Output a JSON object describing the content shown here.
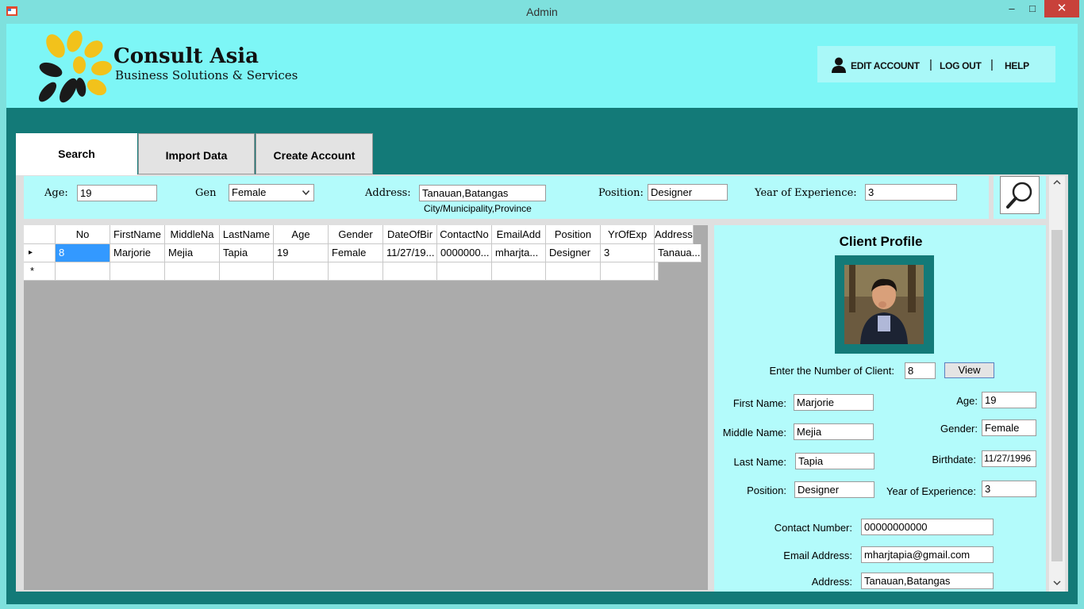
{
  "window": {
    "title": "Admin",
    "minimize": "–",
    "maximize": "□",
    "close": "✕"
  },
  "brand": {
    "name": "Consult Asia",
    "tagline": "Business Solutions & Services"
  },
  "header": {
    "edit_account": "EDIT ACCOUNT",
    "log_out": "LOG OUT",
    "help": "HELP",
    "separator": "|"
  },
  "tabs": [
    {
      "label": "Search"
    },
    {
      "label": "Import Data"
    },
    {
      "label": "Create Account"
    }
  ],
  "filters": {
    "age_label": "Age:",
    "age_value": "19",
    "gen_label": "Gen",
    "gen_value": "Female",
    "address_label": "Address:",
    "address_value": "Tanauan,Batangas",
    "address_hint": "City/Municipality,Province",
    "position_label": "Position:",
    "position_value": "Designer",
    "yoe_label": "Year of Experience:",
    "yoe_value": "3"
  },
  "grid": {
    "columns": [
      "No",
      "FirstName",
      "MiddleNa",
      "LastName",
      "Age",
      "Gender",
      "DateOfBir",
      "ContactNo",
      "EmailAdd",
      "Position",
      "YrOfExp",
      "Address"
    ],
    "rows": [
      [
        "8",
        "Marjorie",
        "Mejia",
        "Tapia",
        "19",
        "Female",
        "11/27/19...",
        "0000000...",
        "mharjta...",
        "Designer",
        "3",
        "Tanaua..."
      ]
    ],
    "new_row_marker": "*",
    "current_row_marker": "▸"
  },
  "profile": {
    "title": "Client Profile",
    "enter_label": "Enter the Number of Client:",
    "client_number": "8",
    "view_label": "View",
    "first_name_label": "First Name:",
    "first_name": "Marjorie",
    "middle_name_label": "Middle Name:",
    "middle_name": "Mejia",
    "last_name_label": "Last Name:",
    "last_name": "Tapia",
    "position_label": "Position:",
    "position": "Designer",
    "age_label": "Age:",
    "age": "19",
    "gender_label": "Gender:",
    "gender": "Female",
    "birthdate_label": "Birthdate:",
    "birthdate": "11/27/1996",
    "yoe_label": "Year of Experience:",
    "yoe": "3",
    "contact_label": "Contact Number:",
    "contact": "00000000000",
    "email_label": "Email Address:",
    "email": "mharjtapia@gmail.com",
    "address_label": "Address:",
    "address": "Tanauan,Batangas"
  },
  "colors": {
    "header_bg": "#7df6f6",
    "main_bg": "#137a78",
    "panel_bg": "#b3fbfb",
    "grid_bg": "#ababab",
    "close_red": "#c8413a",
    "logo_yellow": "#f2c21b"
  },
  "icons": {
    "app": "window-icon",
    "user": "user-icon",
    "search": "magnifier-icon",
    "dropdown": "chevron-down-icon"
  }
}
